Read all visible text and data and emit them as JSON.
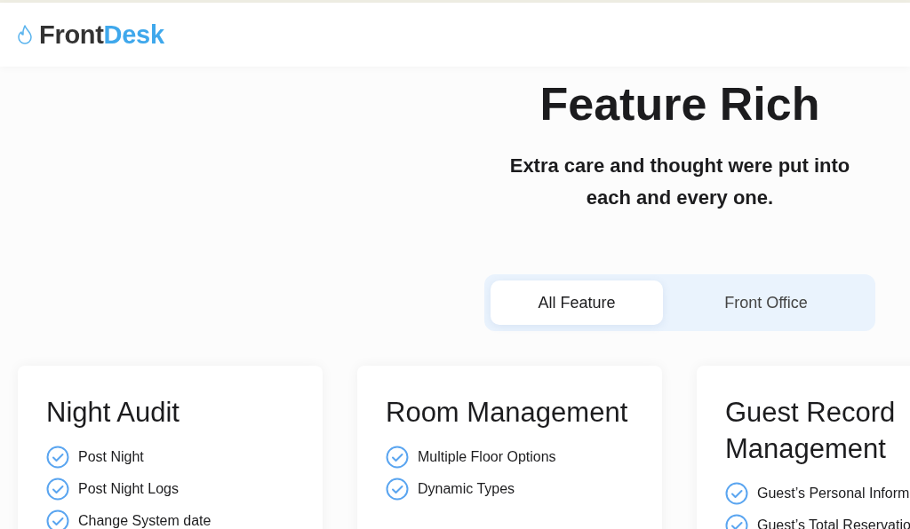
{
  "header": {
    "logo": {
      "primary": "Front",
      "accent": "Desk"
    }
  },
  "hero": {
    "title": "Feature Rich",
    "subtitle": "Extra care and thought were put into each and every one."
  },
  "tabs": [
    {
      "label": "All Feature",
      "selected": true
    },
    {
      "label": "Front Office",
      "selected": false
    }
  ],
  "cards": [
    {
      "title": "Night Audit",
      "items": [
        "Post Night",
        "Post Night Logs",
        "Change System date"
      ]
    },
    {
      "title": "Room Management",
      "items": [
        "Multiple Floor Options",
        "Dynamic Types"
      ]
    },
    {
      "title": "Guest Record Management",
      "items": [
        "Guest’s Personal Inform",
        "Guest’s Total Reservatio"
      ]
    }
  ]
}
